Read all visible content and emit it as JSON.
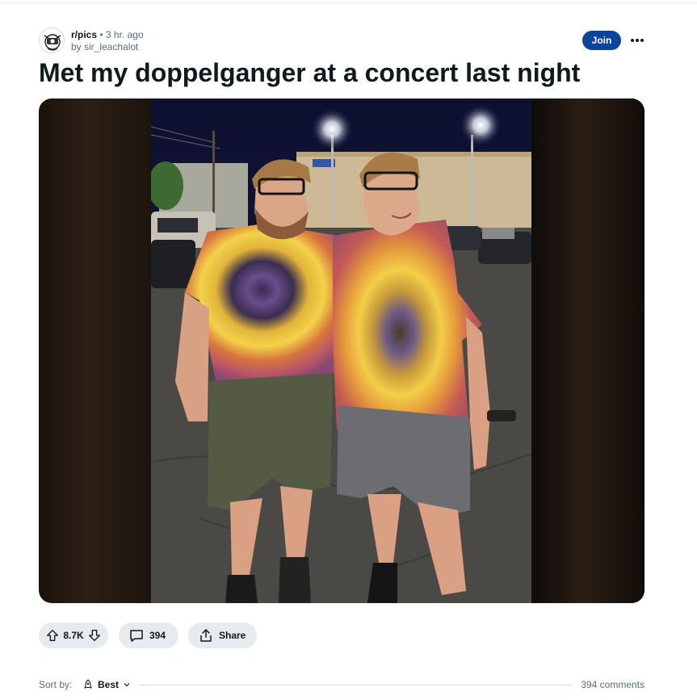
{
  "post": {
    "subreddit": "r/pics",
    "separator": "•",
    "time": "3 hr. ago",
    "author": "by sir_leachalot",
    "title": "Met my doppelganger at a concert last night",
    "join_label": "Join"
  },
  "actions": {
    "votes": "8.7K",
    "comments": "394",
    "share_label": "Share"
  },
  "sort": {
    "label": "Sort by:",
    "value": "Best",
    "comment_count": "394 comments"
  },
  "icons": {
    "upvote": "arrow-up-icon",
    "downvote": "arrow-down-icon",
    "comment": "comment-bubble-icon",
    "share": "share-icon",
    "more": "more-horizontal-icon",
    "sort": "rocket-icon",
    "chevron": "chevron-down-icon"
  },
  "colors": {
    "join": "#0a449b",
    "pill_bg": "#e5ebee",
    "meta_text": "#576f76"
  }
}
